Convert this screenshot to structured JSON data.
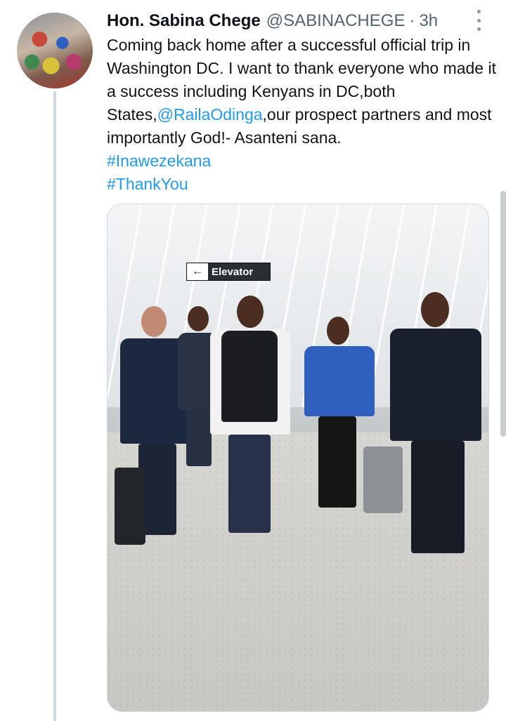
{
  "tweet": {
    "display_name": "Hon. Sabina Chege",
    "handle": "@SABINACHEGE",
    "separator": "·",
    "time": "3h",
    "text_part1": "Coming back home after a successful official trip in Washington DC. I want to thank everyone who made it a success including Kenyans in DC,both States,",
    "mention": "@RailaOdinga",
    "text_part2": ",our prospect partners and most importantly God!- Asanteni sana.",
    "hashtags": [
      "#Inawezekana",
      "#ThankYou"
    ]
  },
  "photo": {
    "sign_arrow": "←",
    "sign_label": "Elevator"
  },
  "colors": {
    "link": "#1d9bf0",
    "text": "#0f1419",
    "secondary": "#536471",
    "thread_line": "#cfd9de"
  },
  "icons": {
    "more": "more-options-icon"
  }
}
